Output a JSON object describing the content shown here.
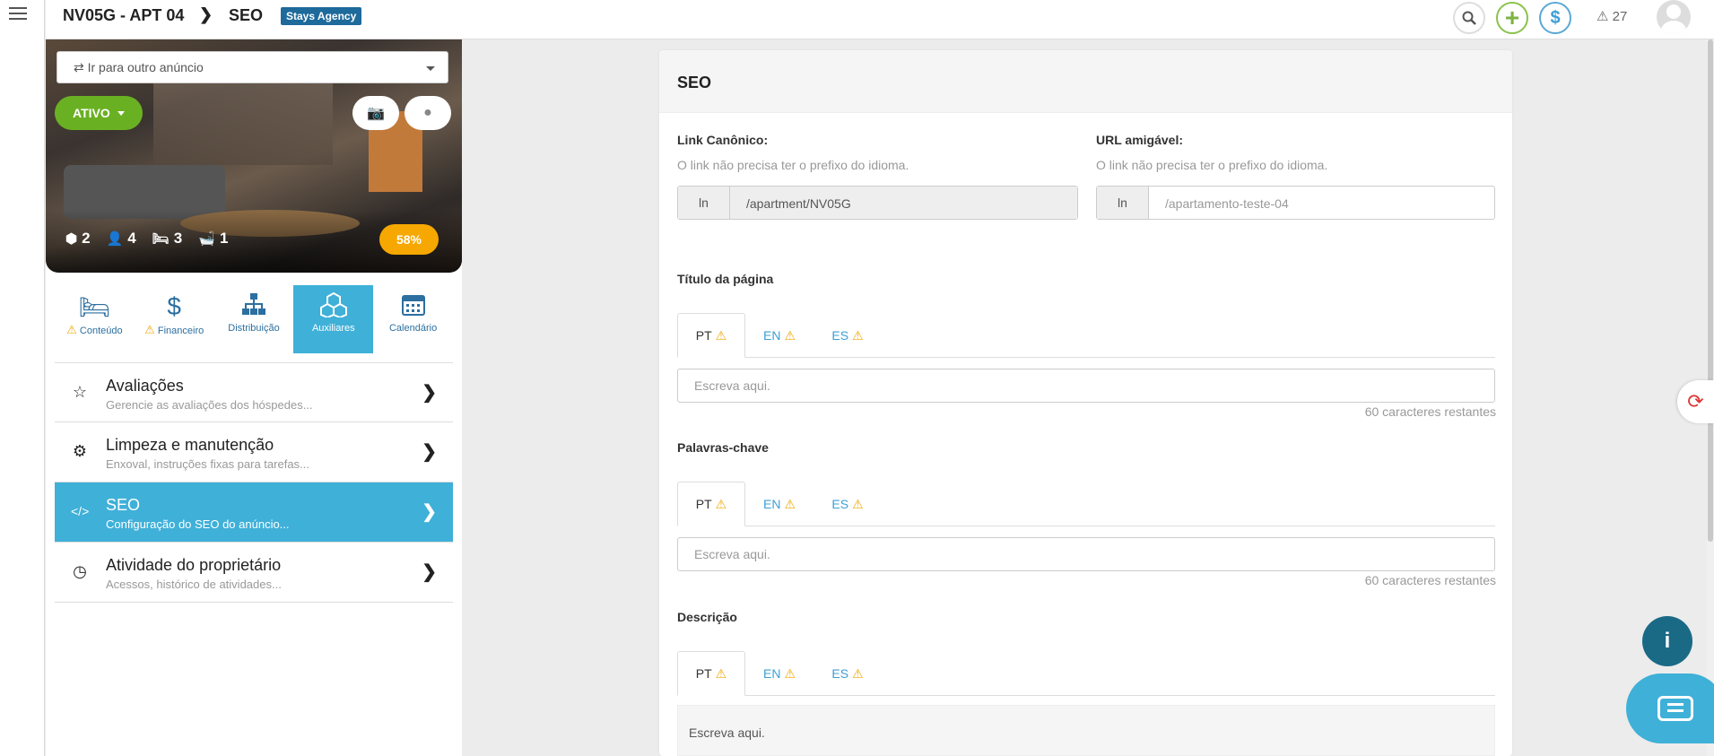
{
  "header": {
    "listing": "NV05G - APT 04",
    "separator": "❯",
    "section": "SEO",
    "agency_badge": "Stays Agency",
    "alerts_count": "27"
  },
  "hero": {
    "goto_placeholder": "⇄ Ir para outro anúncio",
    "status_label": "ATIVO",
    "stats": {
      "rooms": "2",
      "guests": "4",
      "beds": "3",
      "baths": "1"
    },
    "completion": "58%"
  },
  "tabs": [
    {
      "label": "Conteúdo",
      "icon": "bed-icon",
      "warning": true
    },
    {
      "label": "Financeiro",
      "icon": "dollar-icon",
      "warning": true
    },
    {
      "label": "Distribuição",
      "icon": "sitemap-icon",
      "warning": false
    },
    {
      "label": "Auxiliares",
      "icon": "cubes-icon",
      "warning": false,
      "active": true
    },
    {
      "label": "Calendário",
      "icon": "calendar-icon",
      "warning": false
    }
  ],
  "menu": [
    {
      "title": "Avaliações",
      "subtitle": "Gerencie as avaliações dos hóspedes...",
      "icon": "star-icon"
    },
    {
      "title": "Limpeza e manutenção",
      "subtitle": "Enxoval, instruções fixas para tarefas...",
      "icon": "gear-icon"
    },
    {
      "title": "SEO",
      "subtitle": "Configuração do SEO do anúncio...",
      "icon": "code-icon",
      "active": true
    },
    {
      "title": "Atividade do proprietário",
      "subtitle": "Acessos, histórico de atividades...",
      "icon": "clock-icon"
    }
  ],
  "seo": {
    "title": "SEO",
    "canonical": {
      "label": "Link Canônico:",
      "help": "O link não precisa ter o prefixo do idioma.",
      "prefix": "ln",
      "value": "/apartment/NV05G"
    },
    "friendly_url": {
      "label": "URL amigável:",
      "help": "O link não precisa ter o prefixo do idioma.",
      "prefix": "ln",
      "placeholder": "/apartamento-teste-04"
    },
    "page_title": {
      "label": "Título da página",
      "placeholder": "Escreva aqui.",
      "counter": "60 caracteres restantes"
    },
    "keywords": {
      "label": "Palavras-chave",
      "placeholder": "Escreva aqui.",
      "counter": "60 caracteres restantes"
    },
    "description": {
      "label": "Descrição",
      "placeholder": "Escreva aqui."
    },
    "languages": [
      "PT",
      "EN",
      "ES"
    ]
  },
  "colors": {
    "accent": "#3fb0d8",
    "active_green": "#6ab023",
    "warning": "#f0a800",
    "completion": "#f7a800",
    "badge": "#1d6a9b"
  }
}
